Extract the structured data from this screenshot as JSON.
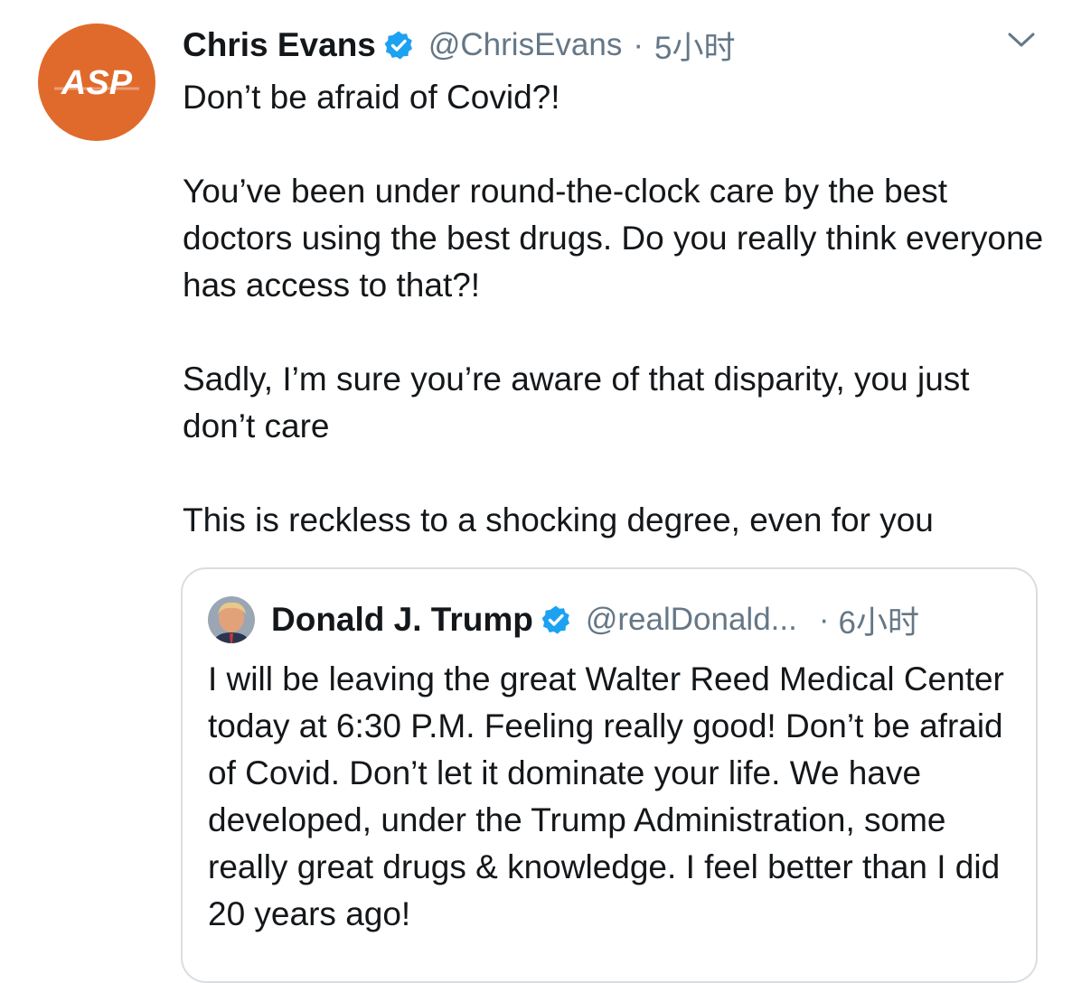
{
  "tweet": {
    "avatar_text": "ASP",
    "display_name": "Chris Evans",
    "handle": "@ChrisEvans",
    "separator": "·",
    "time": "5小时",
    "paragraphs": [
      "Don’t be afraid of Covid?!",
      "You’ve been under round-the-clock care by the best doctors using the best drugs. Do you really think everyone has access to that?!",
      "Sadly, I’m sure you’re aware of that disparity, you just don’t care",
      "This is reckless to a shocking degree, even for you"
    ]
  },
  "quoted_tweet": {
    "display_name": "Donald J. Trump",
    "handle": "@realDonald...",
    "separator": "·",
    "time": "6小时",
    "text": "I will be leaving the great Walter Reed Medical Center today at 6:30 P.M. Feeling really good! Don’t be afraid of Covid. Don’t let it dominate your life. We have developed, under the Trump Administration, some really great drugs & knowledge. I feel better than I did 20 years ago!"
  },
  "colors": {
    "avatar_bg": "#e06a2c",
    "verified": "#1da1f2",
    "secondary_text": "#657786",
    "border": "#d9dde1"
  },
  "icons": [
    "verified-badge-icon",
    "chevron-down-icon"
  ]
}
